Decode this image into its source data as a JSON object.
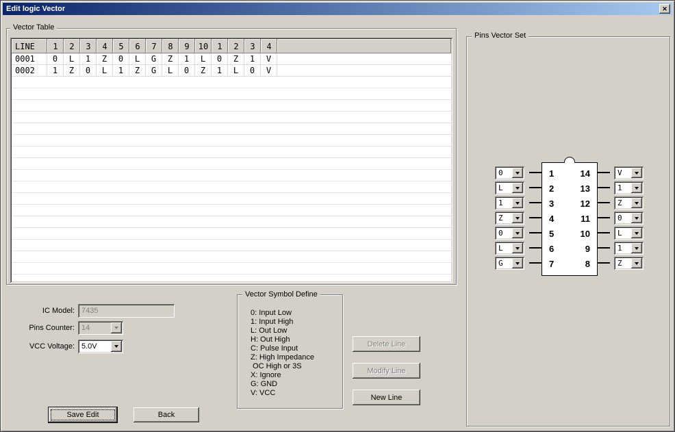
{
  "window": {
    "title": "Edit logic Vector",
    "close_icon": "✕"
  },
  "colors": {
    "face": "#d4d0c8",
    "title_gradient_start": "#0a246a",
    "title_gradient_end": "#a6caf0",
    "grid_bg": "#ffffff"
  },
  "vector_table": {
    "group_label": "Vector Table",
    "headers": [
      "LINE",
      "1",
      "2",
      "3",
      "4",
      "5",
      "6",
      "7",
      "8",
      "9",
      "10",
      "1",
      "2",
      "3",
      "4"
    ],
    "rows": [
      {
        "line": "0001",
        "values": [
          "0",
          "L",
          "1",
          "Z",
          "0",
          "L",
          "G",
          "Z",
          "1",
          "L",
          "0",
          "Z",
          "1",
          "V"
        ]
      },
      {
        "line": "0002",
        "values": [
          "1",
          "Z",
          "0",
          "L",
          "1",
          "Z",
          "G",
          "L",
          "0",
          "Z",
          "1",
          "L",
          "0",
          "V"
        ]
      }
    ]
  },
  "pins_vector_set": {
    "group_label": "Pins Vector Set",
    "left_pins": [
      {
        "pin": "1",
        "value": "0"
      },
      {
        "pin": "2",
        "value": "L"
      },
      {
        "pin": "3",
        "value": "1"
      },
      {
        "pin": "4",
        "value": "Z"
      },
      {
        "pin": "5",
        "value": "0"
      },
      {
        "pin": "6",
        "value": "L"
      },
      {
        "pin": "7",
        "value": "G"
      }
    ],
    "right_pins": [
      {
        "pin": "14",
        "value": "V"
      },
      {
        "pin": "13",
        "value": "1"
      },
      {
        "pin": "12",
        "value": "Z"
      },
      {
        "pin": "11",
        "value": "0"
      },
      {
        "pin": "10",
        "value": "L"
      },
      {
        "pin": "9",
        "value": "1"
      },
      {
        "pin": "8",
        "value": "Z"
      }
    ]
  },
  "settings": {
    "ic_model_label": "IC Model:",
    "ic_model_value": "7435",
    "pins_counter_label": "Pins Counter:",
    "pins_counter_value": "14",
    "vcc_voltage_label": "VCC Voltage:",
    "vcc_voltage_value": "5.0V"
  },
  "symbol_define": {
    "group_label": "Vector Symbol Define",
    "lines": [
      "0: Input Low",
      "1: Input High",
      "L: Out Low",
      "H: Out High",
      "C: Pulse Input",
      "Z: High Impedance",
      " OC High or 3S",
      "X: Ignore",
      "G: GND",
      "V: VCC"
    ]
  },
  "buttons": {
    "delete_line": "Delete Line",
    "modify_line": "Modify Line",
    "new_line": "New Line",
    "save_edit": "Save Edit",
    "back": "Back"
  }
}
